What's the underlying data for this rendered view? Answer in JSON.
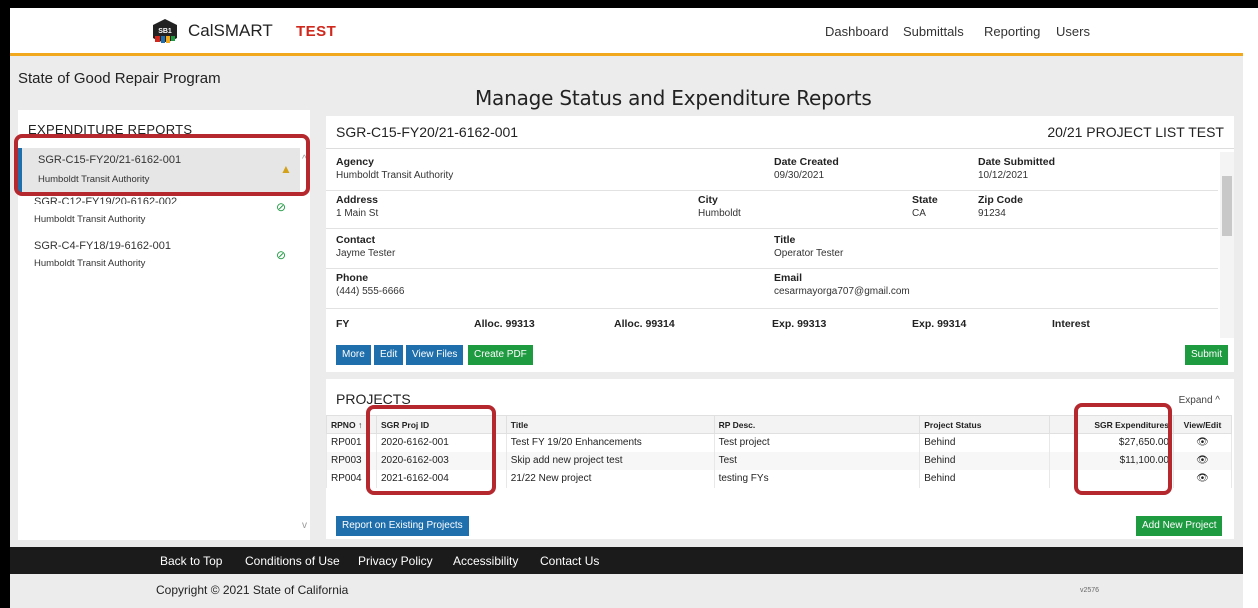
{
  "header": {
    "brand": "CalSMART",
    "logo_text": "SB1",
    "environment": "TEST",
    "nav": [
      "Dashboard",
      "Submittals",
      "Reporting",
      "Users"
    ]
  },
  "program_title": "State of Good Repair Program",
  "page_title": "Manage Status and Expenditure Reports",
  "sidebar": {
    "heading": "EXPENDITURE REPORTS",
    "reports": [
      {
        "id": "SGR-C15-FY20/21-6162-001",
        "agency": "Humboldt Transit Authority",
        "status": "warning-icon"
      },
      {
        "id": "SGR-C12-FY19/20-6162-002",
        "agency": "Humboldt Transit Authority",
        "status": "check-icon"
      },
      {
        "id": "SGR-C4-FY18/19-6162-001",
        "agency": "Humboldt Transit Authority",
        "status": "check-icon"
      }
    ]
  },
  "detail": {
    "id": "SGR-C15-FY20/21-6162-001",
    "list_label": "20/21 PROJECT LIST TEST",
    "agency_label": "Agency",
    "agency": "Humboldt Transit Authority",
    "date_created_label": "Date Created",
    "date_created": "09/30/2021",
    "date_submitted_label": "Date Submitted",
    "date_submitted": "10/12/2021",
    "address_label": "Address",
    "address": "1 Main St",
    "city_label": "City",
    "city": "Humboldt",
    "state_label": "State",
    "state": "CA",
    "zip_label": "Zip Code",
    "zip": "91234",
    "contact_label": "Contact",
    "contact": "Jayme Tester",
    "title_label": "Title",
    "title": "Operator Tester",
    "phone_label": "Phone",
    "phone": "(444) 555-6666",
    "email_label": "Email",
    "email": "cesarmayorga707@gmail.com",
    "fy_headers": [
      "FY",
      "Alloc. 99313",
      "Alloc. 99314",
      "Exp. 99313",
      "Exp. 99314",
      "Interest"
    ],
    "buttons": {
      "more": "More",
      "edit": "Edit",
      "view_files": "View Files",
      "create_pdf": "Create PDF",
      "submit": "Submit"
    }
  },
  "projects": {
    "heading": "PROJECTS",
    "expand": "Expand ^",
    "columns": [
      "RPNO",
      "SGR Proj ID",
      "Title",
      "RP Desc.",
      "Project Status",
      "SGR Expenditures",
      "View/Edit"
    ],
    "rows": [
      {
        "rpno": "RP001",
        "proj_id": "2020-6162-001",
        "title": "Test FY 19/20 Enhancements",
        "desc": "Test project",
        "status": "Behind",
        "exp": "$27,650.00"
      },
      {
        "rpno": "RP003",
        "proj_id": "2020-6162-003",
        "title": "Skip add new project test",
        "desc": "Test",
        "status": "Behind",
        "exp": "$11,100.00"
      },
      {
        "rpno": "RP004",
        "proj_id": "2021-6162-004",
        "title": "21/22 New project",
        "desc": "testing FYs",
        "status": "Behind",
        "exp": ""
      }
    ],
    "buttons": {
      "report_existing": "Report on Existing Projects",
      "add_new": "Add New Project"
    }
  },
  "footer": {
    "links": [
      "Back to Top",
      "Conditions of Use",
      "Privacy Policy",
      "Accessibility",
      "Contact Us"
    ],
    "copyright": "Copyright © 2021 State of California",
    "version": "v2576"
  },
  "colors": {
    "accent": "#f2a81d",
    "primary": "#1f6fad",
    "success": "#1e9a41",
    "highlight": "#b5282e"
  }
}
